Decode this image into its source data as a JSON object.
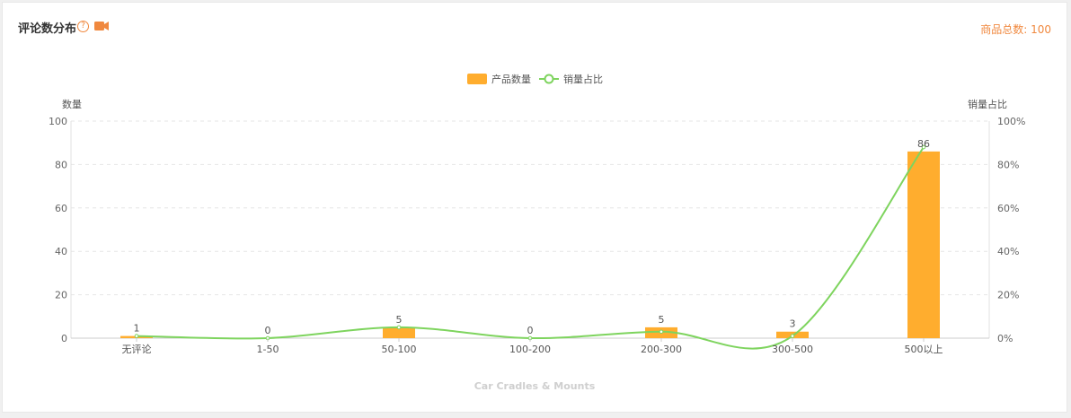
{
  "header": {
    "title": "评论数分布",
    "help_icon": "question-circle-icon",
    "video_icon": "video-camera-icon",
    "total_label": "商品总数:",
    "total_value": "100"
  },
  "colors": {
    "bar": "#ffad2e",
    "line": "#7ed45e",
    "accent": "#f0883e"
  },
  "chart_data": {
    "type": "bar",
    "categories": [
      "无评论",
      "1-50",
      "50-100",
      "100-200",
      "200-300",
      "300-500",
      "500以上"
    ],
    "series": [
      {
        "name": "产品数量",
        "type": "bar",
        "axis": "left",
        "values": [
          1,
          0,
          5,
          0,
          5,
          3,
          86
        ]
      },
      {
        "name": "销量占比",
        "type": "line",
        "axis": "right",
        "values": [
          1,
          0,
          5,
          0,
          3,
          1,
          88
        ]
      }
    ],
    "data_labels": [
      "1",
      "0",
      "5",
      "0",
      "5",
      "3",
      "86"
    ],
    "ylabel": "数量",
    "ylabel_right": "销量占比",
    "ylim": [
      0,
      100
    ],
    "ylim_right": [
      0,
      100
    ],
    "yticks": [
      "0",
      "20",
      "40",
      "60",
      "80",
      "100"
    ],
    "yticks_right": [
      "0%",
      "20%",
      "40%",
      "60%",
      "80%",
      "100%"
    ],
    "xlabel": "Car Cradles & Mounts",
    "legend": "top-center",
    "grid": true
  }
}
